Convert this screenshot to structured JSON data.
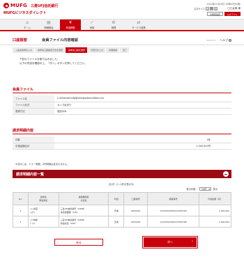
{
  "header": {
    "logo": "MUFG",
    "bank_name": "三菱UFJ信託銀行",
    "service_name": "MUFGビジネスダイレクト",
    "login_time": "2014年11月19日 10時00分00秒",
    "font_size_label": "文字サイズ",
    "font_sizes": [
      "小",
      "中",
      "大"
    ],
    "user_name": "〇〇太郎 様",
    "btn_settings": "お客様設定",
    "btn_logout": "ログアウト"
  },
  "gnav": [
    {
      "label": "ホーム",
      "icon": "home-icon",
      "glyph": "⌂"
    },
    {
      "label": "明細照会",
      "icon": "document-icon",
      "glyph": "▤"
    },
    {
      "label": "資金移動",
      "icon": "transfer-icon",
      "glyph": "¥"
    },
    {
      "label": "承認",
      "icon": "approve-icon",
      "glyph": "✓"
    },
    {
      "label": "管理",
      "icon": "manage-icon",
      "glyph": "⚙"
    },
    {
      "label": "サービス連携",
      "icon": "link-icon",
      "glyph": "⇄"
    }
  ],
  "title": {
    "category": "口座振替",
    "main": "会員ファイル内容確認",
    "page_id": "BKZF007",
    "help": "ヘルプ",
    "help_glyph": "?"
  },
  "steps": [
    "入金先情報を入力",
    "請求先口座指定方法を選択",
    "請求先口座を選択",
    "請求先口座を選択",
    "引落日を入力",
    "内容確認",
    "完了"
  ],
  "intro": {
    "line1": "下記のファイルを取り込みました。",
    "line2": "以下の内容を確認の上、「次へ」ボタンを押してください。"
  },
  "member_file": {
    "heading": "会員ファイル",
    "rows": [
      {
        "label": "ファイル名",
        "value": "C:¥Users¥mufg¥Desktop¥sendData.csv"
      },
      {
        "label": "ファイル形式",
        "value": "カンマ区切り"
      },
      {
        "label": "登録方法",
        "value": "追加のみ"
      }
    ]
  },
  "request_content": {
    "heading": "請求明細内容",
    "rows": [
      {
        "label": "件数",
        "value": "2件"
      },
      {
        "label": "引落金額合計",
        "value": "2,000,000円"
      }
    ],
    "note": "※合計には、エラー明細、0円明細は含まれません。"
  },
  "list": {
    "heading": "請求明細内容一覧",
    "count": "全2件（1～2件を表示中）",
    "per_page_label": "表示件数：",
    "per_page_value": "10件",
    "per_page_suffix": "表示",
    "headers": {
      "no": "No.",
      "payer": "請求先\n預金者名",
      "bank": "金融機関名\n支店名",
      "type": "科目",
      "account": "口座番号",
      "customer_no": "顧客番号",
      "amount": "引落金額（円）"
    },
    "rows": [
      {
        "no": "1",
        "payer1": "○○商店",
        "payer2": "ｼｮｳﾃﾝ",
        "bank1": "三菱UFJ信託銀行（0288）",
        "bank2": "本店営業部（100）",
        "type": "普通",
        "account": "6000001",
        "customer_no": "A1234567890123456789",
        "amount": "1,000,000"
      },
      {
        "no": "2",
        "payer1": "○○物産",
        "payer2": "ﾌﾞｯｻﾝ",
        "bank1": "三菱UFJ信託銀行（0288）",
        "bank2": "新宿支店（200）",
        "type": "普通",
        "account": "6000002",
        "customer_no": "A1234567890123456788",
        "amount": "1,000,000"
      }
    ]
  },
  "buttons": {
    "back": "戻る",
    "next": "次へ",
    "back_glyph": "‹",
    "next_glyph": "›"
  },
  "colors": {
    "brand_red": "#c8000c",
    "band_red": "#9c0b14"
  }
}
